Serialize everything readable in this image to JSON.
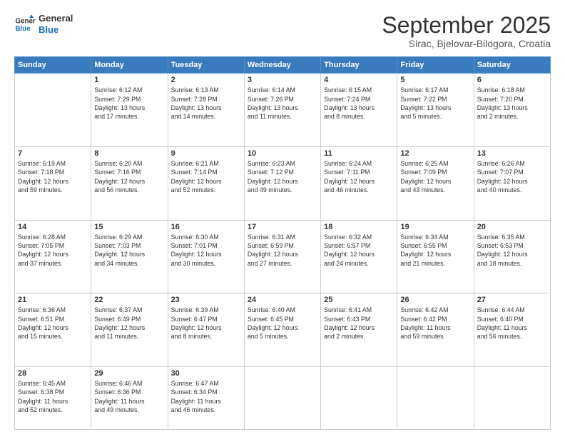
{
  "header": {
    "logo_general": "General",
    "logo_blue": "Blue",
    "month_title": "September 2025",
    "location": "Sirac, Bjelovar-Bilogora, Croatia"
  },
  "days_of_week": [
    "Sunday",
    "Monday",
    "Tuesday",
    "Wednesday",
    "Thursday",
    "Friday",
    "Saturday"
  ],
  "weeks": [
    [
      {
        "day": "",
        "info": ""
      },
      {
        "day": "1",
        "info": "Sunrise: 6:12 AM\nSunset: 7:29 PM\nDaylight: 13 hours\nand 17 minutes."
      },
      {
        "day": "2",
        "info": "Sunrise: 6:13 AM\nSunset: 7:28 PM\nDaylight: 13 hours\nand 14 minutes."
      },
      {
        "day": "3",
        "info": "Sunrise: 6:14 AM\nSunset: 7:26 PM\nDaylight: 13 hours\nand 11 minutes."
      },
      {
        "day": "4",
        "info": "Sunrise: 6:15 AM\nSunset: 7:24 PM\nDaylight: 13 hours\nand 8 minutes."
      },
      {
        "day": "5",
        "info": "Sunrise: 6:17 AM\nSunset: 7:22 PM\nDaylight: 13 hours\nand 5 minutes."
      },
      {
        "day": "6",
        "info": "Sunrise: 6:18 AM\nSunset: 7:20 PM\nDaylight: 13 hours\nand 2 minutes."
      }
    ],
    [
      {
        "day": "7",
        "info": "Sunrise: 6:19 AM\nSunset: 7:18 PM\nDaylight: 12 hours\nand 59 minutes."
      },
      {
        "day": "8",
        "info": "Sunrise: 6:20 AM\nSunset: 7:16 PM\nDaylight: 12 hours\nand 56 minutes."
      },
      {
        "day": "9",
        "info": "Sunrise: 6:21 AM\nSunset: 7:14 PM\nDaylight: 12 hours\nand 52 minutes."
      },
      {
        "day": "10",
        "info": "Sunrise: 6:23 AM\nSunset: 7:12 PM\nDaylight: 12 hours\nand 49 minutes."
      },
      {
        "day": "11",
        "info": "Sunrise: 6:24 AM\nSunset: 7:11 PM\nDaylight: 12 hours\nand 46 minutes."
      },
      {
        "day": "12",
        "info": "Sunrise: 6:25 AM\nSunset: 7:09 PM\nDaylight: 12 hours\nand 43 minutes."
      },
      {
        "day": "13",
        "info": "Sunrise: 6:26 AM\nSunset: 7:07 PM\nDaylight: 12 hours\nand 40 minutes."
      }
    ],
    [
      {
        "day": "14",
        "info": "Sunrise: 6:28 AM\nSunset: 7:05 PM\nDaylight: 12 hours\nand 37 minutes."
      },
      {
        "day": "15",
        "info": "Sunrise: 6:29 AM\nSunset: 7:03 PM\nDaylight: 12 hours\nand 34 minutes."
      },
      {
        "day": "16",
        "info": "Sunrise: 6:30 AM\nSunset: 7:01 PM\nDaylight: 12 hours\nand 30 minutes."
      },
      {
        "day": "17",
        "info": "Sunrise: 6:31 AM\nSunset: 6:59 PM\nDaylight: 12 hours\nand 27 minutes."
      },
      {
        "day": "18",
        "info": "Sunrise: 6:32 AM\nSunset: 6:57 PM\nDaylight: 12 hours\nand 24 minutes."
      },
      {
        "day": "19",
        "info": "Sunrise: 6:34 AM\nSunset: 6:55 PM\nDaylight: 12 hours\nand 21 minutes."
      },
      {
        "day": "20",
        "info": "Sunrise: 6:35 AM\nSunset: 6:53 PM\nDaylight: 12 hours\nand 18 minutes."
      }
    ],
    [
      {
        "day": "21",
        "info": "Sunrise: 6:36 AM\nSunset: 6:51 PM\nDaylight: 12 hours\nand 15 minutes."
      },
      {
        "day": "22",
        "info": "Sunrise: 6:37 AM\nSunset: 6:49 PM\nDaylight: 12 hours\nand 11 minutes."
      },
      {
        "day": "23",
        "info": "Sunrise: 6:39 AM\nSunset: 6:47 PM\nDaylight: 12 hours\nand 8 minutes."
      },
      {
        "day": "24",
        "info": "Sunrise: 6:40 AM\nSunset: 6:45 PM\nDaylight: 12 hours\nand 5 minutes."
      },
      {
        "day": "25",
        "info": "Sunrise: 6:41 AM\nSunset: 6:43 PM\nDaylight: 12 hours\nand 2 minutes."
      },
      {
        "day": "26",
        "info": "Sunrise: 6:42 AM\nSunset: 6:42 PM\nDaylight: 11 hours\nand 59 minutes."
      },
      {
        "day": "27",
        "info": "Sunrise: 6:44 AM\nSunset: 6:40 PM\nDaylight: 11 hours\nand 56 minutes."
      }
    ],
    [
      {
        "day": "28",
        "info": "Sunrise: 6:45 AM\nSunset: 6:38 PM\nDaylight: 11 hours\nand 52 minutes."
      },
      {
        "day": "29",
        "info": "Sunrise: 6:46 AM\nSunset: 6:36 PM\nDaylight: 11 hours\nand 49 minutes."
      },
      {
        "day": "30",
        "info": "Sunrise: 6:47 AM\nSunset: 6:34 PM\nDaylight: 11 hours\nand 46 minutes."
      },
      {
        "day": "",
        "info": ""
      },
      {
        "day": "",
        "info": ""
      },
      {
        "day": "",
        "info": ""
      },
      {
        "day": "",
        "info": ""
      }
    ]
  ]
}
